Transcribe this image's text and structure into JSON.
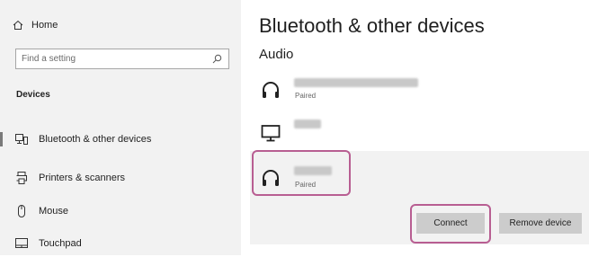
{
  "sidebar": {
    "home_label": "Home",
    "search_placeholder": "Find a setting",
    "section_label": "Devices",
    "items": [
      {
        "label": "Bluetooth & other devices",
        "icon": "bluetooth-devices-icon",
        "active": true
      },
      {
        "label": "Printers & scanners",
        "icon": "printer-icon",
        "active": false
      },
      {
        "label": "Mouse",
        "icon": "mouse-icon",
        "active": false
      },
      {
        "label": "Touchpad",
        "icon": "touchpad-icon",
        "active": false
      }
    ]
  },
  "main": {
    "title": "Bluetooth & other devices",
    "section": "Audio",
    "devices": [
      {
        "icon": "headphones-icon",
        "status": "Paired"
      },
      {
        "icon": "monitor-icon",
        "status": ""
      },
      {
        "icon": "headphones-icon",
        "status": "Paired",
        "selected": true
      }
    ],
    "connect_label": "Connect",
    "remove_label": "Remove device"
  },
  "colors": {
    "sidebar_bg": "#f2f2f2",
    "highlight": "#b85e92",
    "button_bg": "#cccccc"
  }
}
